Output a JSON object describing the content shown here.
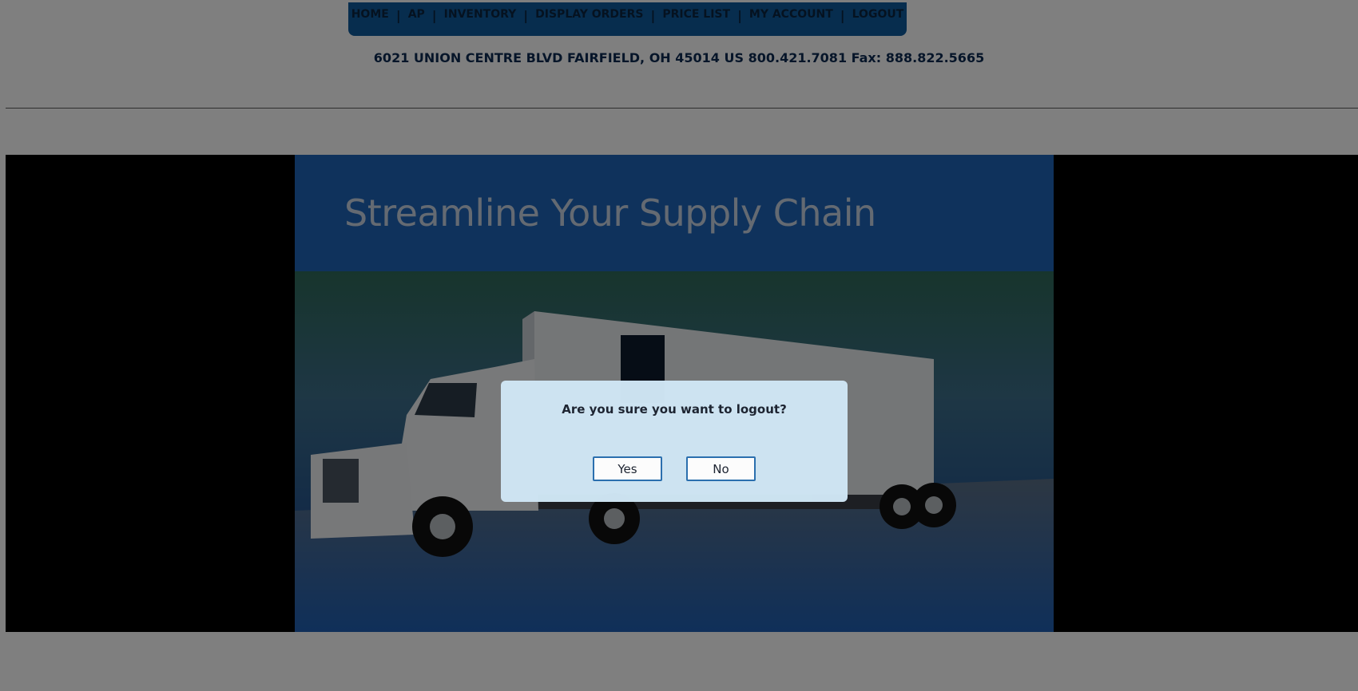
{
  "nav": {
    "items": [
      "HOME",
      "AP",
      "INVENTORY",
      "DISPLAY ORDERS",
      "PRICE LIST",
      "MY ACCOUNT",
      "LOGOUT"
    ],
    "separator": "|"
  },
  "address": "6021 UNION CENTRE BLVD FAIRFIELD, OH 45014 US 800.421.7081 Fax: 888.822.5665",
  "banner": {
    "title": "Streamline Your Supply Chain"
  },
  "dialog": {
    "message": "Are you sure you want to logout?",
    "yes_label": "Yes",
    "no_label": "No"
  },
  "colors": {
    "nav_bg": "#0f5a9c",
    "banner_bg": "#1e65b8",
    "dialog_bg": "#cfe6f4",
    "button_border": "#2a6fb0"
  }
}
